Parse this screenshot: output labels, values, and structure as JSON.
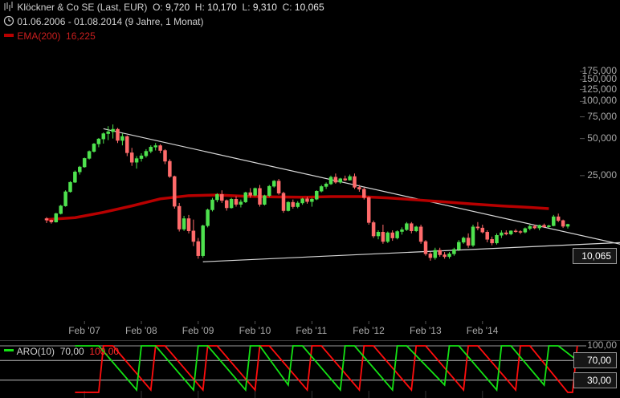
{
  "header": {
    "name_line": "Klöckner & Co SE (Last, EUR)",
    "ohlc": [
      {
        "label": "O:",
        "value": "9,720"
      },
      {
        "label": "H:",
        "value": "10,170"
      },
      {
        "label": "L:",
        "value": "9,310"
      },
      {
        "label": "C:",
        "value": "10,065"
      }
    ],
    "period": "01.06.2006 - 01.08.2014 (9 Jahre, 1 Monat)",
    "ema_label": "EMA(200)",
    "ema_value": "16,225",
    "icons": {
      "chart": "chart-icon",
      "clock": "clock-icon"
    }
  },
  "colors": {
    "up": "#4ee24e",
    "down": "#ff6b6b",
    "ema": "#b80000",
    "trendline": "#d8d8d8",
    "aroon_up": "#14e214",
    "aroon_down": "#ff0d0d"
  },
  "price_badge": "10,065",
  "aroon_panel": {
    "label": "ARO(10)",
    "up_value": "70,00",
    "down_value": "100,00",
    "levels": [
      "100,00",
      "70,00",
      "30,00"
    ],
    "badges": [
      "70,00",
      "30,00"
    ]
  },
  "chart_data": {
    "type": "candlestick",
    "title": "Klöckner & Co SE (Last, EUR)",
    "y_scale": "log",
    "y_ticks": [
      "175,000",
      "150,000",
      "125,000",
      "100,000",
      "75,000",
      "50,000",
      "25,000"
    ],
    "x_ticks": [
      "Feb '07",
      "Feb '08",
      "Feb '09",
      "Feb '10",
      "Feb '11",
      "Feb '12",
      "Feb '13",
      "Feb '14"
    ],
    "interval": "monthly",
    "start": "2006-06",
    "end": "2014-08",
    "candles": [
      [
        11.2,
        11.5,
        10.3,
        10.9
      ],
      [
        10.9,
        11.0,
        10.2,
        10.5
      ],
      [
        10.5,
        12.5,
        10.4,
        12.3
      ],
      [
        12.3,
        14.5,
        12.1,
        14.2
      ],
      [
        14.2,
        19.0,
        14.0,
        18.5
      ],
      [
        18.5,
        22.5,
        18.2,
        22.1
      ],
      [
        22.1,
        27.5,
        21.8,
        26.8
      ],
      [
        26.8,
        30.0,
        25.5,
        29.4
      ],
      [
        29.4,
        35.0,
        29.0,
        34.5
      ],
      [
        34.5,
        40.0,
        33.8,
        39.3
      ],
      [
        39.3,
        46.0,
        38.5,
        45.2
      ],
      [
        45.2,
        50.5,
        42.5,
        49.6
      ],
      [
        49.6,
        56.0,
        45.5,
        54.8
      ],
      [
        54.8,
        63.0,
        48.5,
        56.8
      ],
      [
        56.8,
        65.0,
        50.0,
        59.5
      ],
      [
        59.5,
        61.0,
        46.0,
        48.2
      ],
      [
        48.2,
        55.0,
        44.0,
        52.0
      ],
      [
        52.0,
        53.0,
        36.0,
        38.3
      ],
      [
        38.3,
        42.0,
        30.0,
        32.1
      ],
      [
        32.1,
        36.0,
        28.5,
        34.4
      ],
      [
        34.4,
        38.0,
        32.5,
        36.2
      ],
      [
        36.2,
        41.0,
        35.0,
        39.4
      ],
      [
        39.4,
        44.0,
        38.0,
        42.6
      ],
      [
        42.6,
        46.0,
        40.0,
        43.8
      ],
      [
        43.8,
        45.0,
        38.0,
        40.0
      ],
      [
        40.0,
        41.0,
        31.0,
        32.7
      ],
      [
        32.7,
        34.0,
        24.0,
        24.6
      ],
      [
        24.6,
        25.0,
        13.5,
        14.1
      ],
      [
        14.1,
        15.0,
        8.8,
        9.2
      ],
      [
        9.2,
        11.8,
        8.9,
        11.2
      ],
      [
        11.2,
        12.0,
        8.5,
        8.9
      ],
      [
        8.9,
        11.0,
        6.7,
        7.3
      ],
      [
        7.3,
        7.8,
        5.3,
        5.6
      ],
      [
        5.6,
        10.0,
        5.4,
        9.8
      ],
      [
        9.8,
        13.5,
        9.5,
        13.2
      ],
      [
        13.2,
        16.5,
        12.8,
        15.9
      ],
      [
        15.9,
        18.0,
        15.2,
        17.6
      ],
      [
        17.6,
        19.0,
        15.0,
        15.7
      ],
      [
        15.7,
        16.0,
        13.0,
        13.7
      ],
      [
        13.7,
        16.5,
        13.5,
        16.1
      ],
      [
        16.1,
        17.0,
        14.0,
        14.6
      ],
      [
        14.6,
        16.0,
        13.8,
        15.3
      ],
      [
        15.3,
        18.5,
        15.0,
        18.2
      ],
      [
        18.2,
        19.8,
        16.5,
        17.3
      ],
      [
        17.3,
        20.0,
        17.0,
        19.7
      ],
      [
        19.7,
        21.0,
        14.0,
        14.6
      ],
      [
        14.6,
        17.5,
        14.3,
        17.2
      ],
      [
        17.2,
        21.0,
        16.8,
        20.5
      ],
      [
        20.5,
        23.0,
        20.0,
        22.6
      ],
      [
        22.6,
        23.5,
        17.5,
        18.0
      ],
      [
        18.0,
        18.5,
        12.5,
        13.0
      ],
      [
        13.0,
        15.5,
        12.8,
        15.2
      ],
      [
        15.2,
        16.0,
        13.5,
        14.0
      ],
      [
        14.0,
        15.5,
        13.6,
        15.0
      ],
      [
        15.0,
        16.5,
        14.5,
        16.2
      ],
      [
        16.2,
        16.8,
        14.8,
        15.4
      ],
      [
        15.4,
        16.5,
        14.0,
        16.1
      ],
      [
        16.1,
        19.0,
        15.8,
        18.7
      ],
      [
        18.7,
        21.0,
        18.3,
        20.4
      ],
      [
        20.4,
        22.0,
        19.5,
        21.4
      ],
      [
        21.4,
        25.0,
        21.0,
        24.3
      ],
      [
        24.3,
        26.0,
        21.5,
        22.1
      ],
      [
        22.1,
        24.0,
        21.5,
        23.6
      ],
      [
        23.6,
        25.0,
        22.5,
        23.0
      ],
      [
        23.0,
        25.5,
        22.8,
        24.6
      ],
      [
        24.6,
        26.0,
        19.5,
        20.1
      ],
      [
        20.1,
        21.0,
        18.5,
        19.4
      ],
      [
        19.4,
        20.0,
        16.0,
        16.6
      ],
      [
        16.6,
        17.0,
        10.0,
        10.4
      ],
      [
        10.4,
        10.8,
        7.8,
        8.1
      ],
      [
        8.1,
        9.0,
        7.6,
        8.7
      ],
      [
        8.7,
        10.0,
        7.0,
        7.3
      ],
      [
        7.3,
        8.8,
        7.1,
        8.6
      ],
      [
        8.6,
        9.0,
        7.4,
        7.8
      ],
      [
        7.8,
        9.0,
        7.6,
        8.8
      ],
      [
        8.8,
        9.5,
        8.3,
        9.1
      ],
      [
        9.1,
        10.5,
        8.9,
        10.2
      ],
      [
        10.2,
        10.5,
        8.5,
        8.9
      ],
      [
        8.9,
        9.8,
        8.7,
        9.6
      ],
      [
        9.6,
        10.0,
        7.0,
        7.3
      ],
      [
        7.3,
        7.5,
        5.6,
        5.8
      ],
      [
        5.8,
        6.0,
        5.1,
        5.4
      ],
      [
        5.4,
        6.5,
        5.2,
        6.2
      ],
      [
        6.2,
        6.5,
        5.5,
        5.7
      ],
      [
        5.7,
        6.0,
        5.3,
        5.5
      ],
      [
        5.5,
        6.0,
        5.3,
        5.8
      ],
      [
        5.8,
        6.5,
        5.6,
        6.3
      ],
      [
        6.3,
        7.5,
        6.1,
        7.2
      ],
      [
        7.2,
        8.0,
        7.0,
        7.8
      ],
      [
        7.8,
        8.5,
        6.5,
        6.8
      ],
      [
        6.8,
        10.0,
        6.6,
        9.6
      ],
      [
        9.6,
        10.5,
        9.0,
        9.4
      ],
      [
        9.4,
        10.0,
        8.5,
        8.7
      ],
      [
        8.7,
        9.0,
        7.2,
        7.6
      ],
      [
        7.6,
        8.0,
        6.8,
        7.1
      ],
      [
        7.1,
        8.5,
        6.9,
        8.2
      ],
      [
        8.2,
        9.0,
        7.8,
        8.6
      ],
      [
        8.6,
        9.0,
        8.2,
        8.4
      ],
      [
        8.4,
        9.0,
        8.2,
        8.9
      ],
      [
        8.9,
        9.2,
        8.6,
        8.8
      ],
      [
        8.8,
        9.0,
        8.4,
        8.7
      ],
      [
        8.7,
        9.5,
        8.5,
        9.3
      ],
      [
        9.3,
        10.0,
        9.0,
        9.7
      ],
      [
        9.7,
        10.0,
        9.2,
        9.4
      ],
      [
        9.4,
        10.0,
        9.0,
        9.9
      ],
      [
        9.9,
        10.2,
        9.4,
        9.6
      ],
      [
        9.6,
        10.0,
        9.4,
        9.8
      ],
      [
        9.8,
        12.0,
        9.7,
        11.6
      ],
      [
        11.6,
        12.3,
        10.5,
        10.8
      ],
      [
        10.8,
        11.0,
        9.4,
        9.7
      ],
      [
        9.7,
        10.17,
        9.31,
        10.065
      ]
    ],
    "ema200": [
      [
        0,
        11.0
      ],
      [
        6,
        11.4
      ],
      [
        12,
        12.6
      ],
      [
        18,
        14.2
      ],
      [
        24,
        16.2
      ],
      [
        30,
        17.2
      ],
      [
        36,
        17.4
      ],
      [
        42,
        17.0
      ],
      [
        48,
        16.8
      ],
      [
        54,
        16.7
      ],
      [
        60,
        16.9
      ],
      [
        66,
        16.9
      ],
      [
        72,
        16.5
      ],
      [
        78,
        15.9
      ],
      [
        84,
        15.3
      ],
      [
        90,
        14.7
      ],
      [
        96,
        14.2
      ],
      [
        102,
        13.8
      ],
      [
        106,
        13.5
      ]
    ],
    "trendlines": [
      {
        "name": "upper",
        "from": [
          12,
          60.0
        ],
        "to": [
          126,
          6.3
        ]
      },
      {
        "name": "lower",
        "from": [
          33,
          5.0
        ],
        "to": [
          126,
          7.3
        ]
      }
    ],
    "aroon": {
      "range": [
        0,
        100
      ],
      "up": [
        [
          0,
          100
        ],
        [
          5,
          100
        ],
        [
          13,
          10
        ],
        [
          14,
          100
        ],
        [
          17,
          100
        ],
        [
          25,
          10
        ],
        [
          26,
          100
        ],
        [
          28,
          100
        ],
        [
          36,
          10
        ],
        [
          37,
          100
        ],
        [
          39,
          100
        ],
        [
          45,
          20
        ],
        [
          46,
          100
        ],
        [
          48,
          100
        ],
        [
          56,
          10
        ],
        [
          57,
          100
        ],
        [
          59,
          100
        ],
        [
          67,
          10
        ],
        [
          68,
          100
        ],
        [
          70,
          100
        ],
        [
          78,
          20
        ],
        [
          79,
          100
        ],
        [
          81,
          100
        ],
        [
          89,
          10
        ],
        [
          90,
          100
        ],
        [
          92,
          100
        ],
        [
          99,
          20
        ],
        [
          100,
          100
        ],
        [
          102,
          100
        ],
        [
          106,
          70
        ]
      ],
      "down": [
        [
          0,
          5
        ],
        [
          5,
          5
        ],
        [
          6,
          100
        ],
        [
          8,
          100
        ],
        [
          16,
          10
        ],
        [
          17,
          100
        ],
        [
          19,
          100
        ],
        [
          27,
          10
        ],
        [
          28,
          100
        ],
        [
          30,
          100
        ],
        [
          38,
          10
        ],
        [
          39,
          100
        ],
        [
          41,
          100
        ],
        [
          49,
          10
        ],
        [
          50,
          100
        ],
        [
          52,
          100
        ],
        [
          60,
          10
        ],
        [
          61,
          100
        ],
        [
          63,
          100
        ],
        [
          71,
          10
        ],
        [
          72,
          100
        ],
        [
          74,
          100
        ],
        [
          82,
          10
        ],
        [
          83,
          100
        ],
        [
          85,
          100
        ],
        [
          93,
          10
        ],
        [
          94,
          100
        ],
        [
          96,
          100
        ],
        [
          104,
          5
        ],
        [
          105,
          5
        ],
        [
          106,
          100
        ]
      ]
    }
  }
}
